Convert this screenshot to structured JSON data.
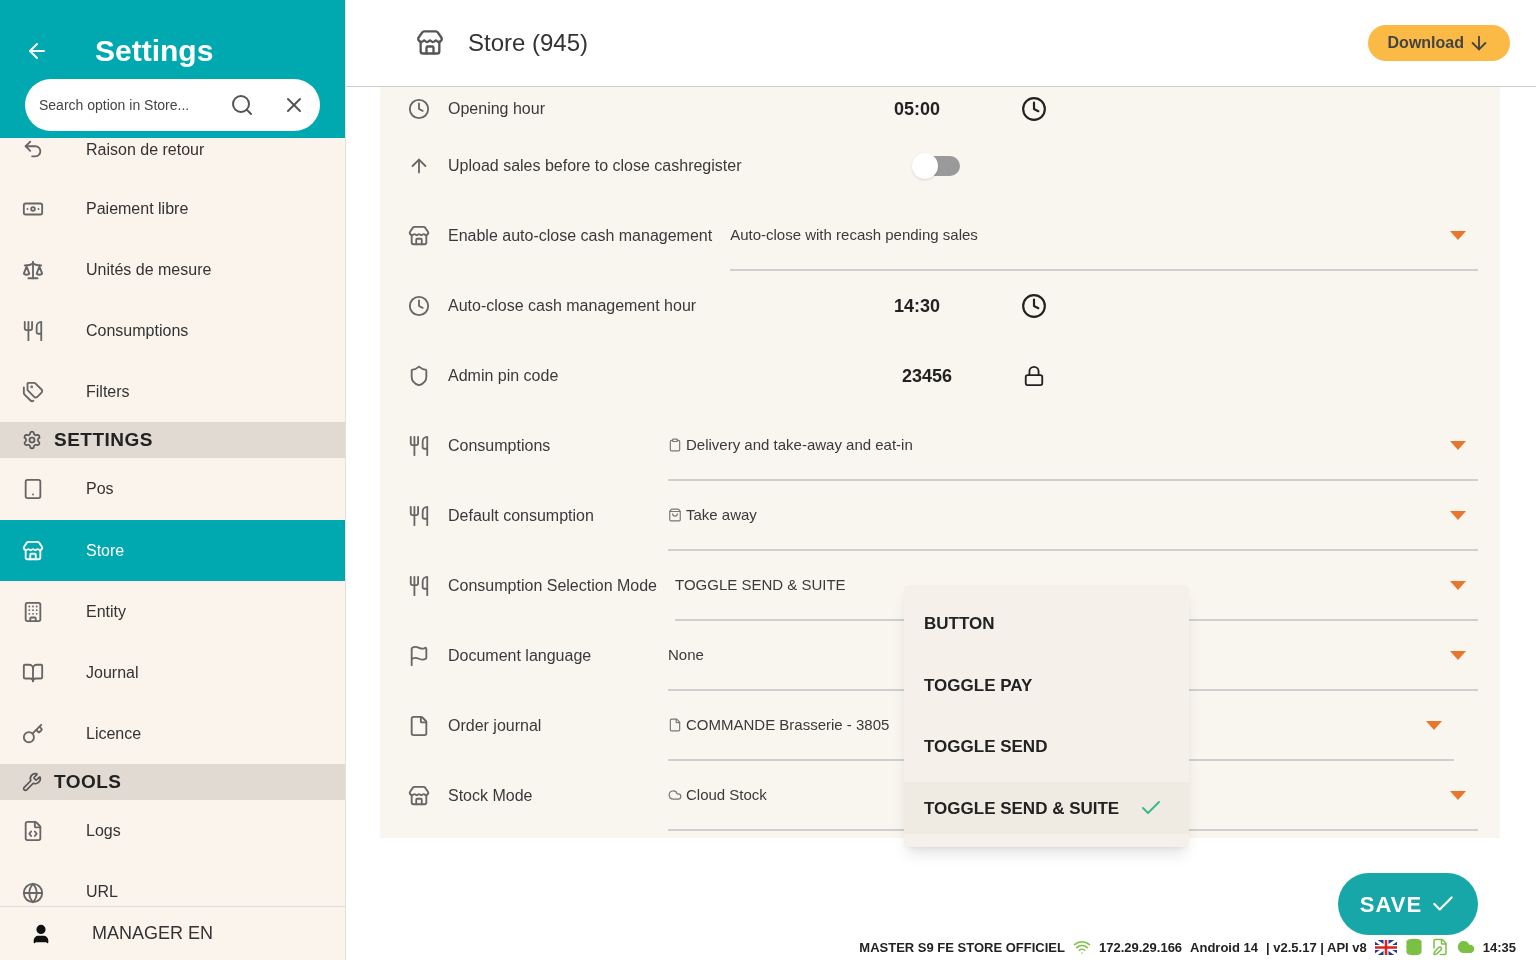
{
  "sidebar": {
    "title": "Settings",
    "search": {
      "placeholder": "Search option in Store..."
    },
    "items": [
      {
        "kind": "item",
        "label": "Raison de retour",
        "selected": false
      },
      {
        "kind": "item",
        "label": "Paiement libre",
        "selected": false
      },
      {
        "kind": "item",
        "label": "Unités de mesure",
        "selected": false
      },
      {
        "kind": "item",
        "label": "Consumptions",
        "selected": false
      },
      {
        "kind": "item",
        "label": "Filters",
        "selected": false
      },
      {
        "kind": "section",
        "label": "SETTINGS"
      },
      {
        "kind": "item",
        "label": "Pos",
        "selected": false
      },
      {
        "kind": "item",
        "label": "Store",
        "selected": true
      },
      {
        "kind": "item",
        "label": "Entity",
        "selected": false
      },
      {
        "kind": "item",
        "label": "Journal",
        "selected": false
      },
      {
        "kind": "item",
        "label": "Licence",
        "selected": false
      },
      {
        "kind": "section",
        "label": "TOOLS"
      },
      {
        "kind": "item",
        "label": "Logs",
        "selected": false
      },
      {
        "kind": "item",
        "label": "URL",
        "selected": false
      }
    ],
    "user": "MANAGER EN"
  },
  "header": {
    "title": "Store (945)",
    "download_button": "Download"
  },
  "settings": [
    {
      "kind": "time",
      "label": "Opening hour",
      "value": "05:00"
    },
    {
      "kind": "toggle",
      "label": "Upload sales before to close cashregister",
      "on": false
    },
    {
      "kind": "select",
      "label": "Enable auto-close cash management",
      "value": "Auto-close with recash pending sales"
    },
    {
      "kind": "time",
      "label": "Auto-close cash management hour",
      "value": "14:30"
    },
    {
      "kind": "pin",
      "label": "Admin pin code",
      "value": "23456"
    },
    {
      "kind": "select",
      "label": "Consumptions",
      "value": "Delivery and take-away and eat-in"
    },
    {
      "kind": "select",
      "label": "Default consumption",
      "value": "Take away"
    },
    {
      "kind": "select",
      "label": "Consumption Selection Mode",
      "value": "TOGGLE SEND & SUITE"
    },
    {
      "kind": "select",
      "label": "Document language",
      "value": "None"
    },
    {
      "kind": "select",
      "label": "Order journal",
      "value": "COMMANDE Brasserie  - 3805"
    },
    {
      "kind": "select",
      "label": "Stock Mode",
      "value": "Cloud Stock"
    }
  ],
  "dropdown": {
    "options": [
      {
        "label": "BUTTON",
        "selected": false
      },
      {
        "label": "TOGGLE PAY",
        "selected": false
      },
      {
        "label": "TOGGLE SEND",
        "selected": false
      },
      {
        "label": "TOGGLE SEND & SUITE",
        "selected": true
      }
    ]
  },
  "save_button": "SAVE",
  "status_bar": {
    "device": "MASTER S9 FE STORE OFFICIEL",
    "ip": "172.29.29.166",
    "os": "Android 14",
    "version": "| v2.5.17 | API v8",
    "time": "14:35"
  }
}
